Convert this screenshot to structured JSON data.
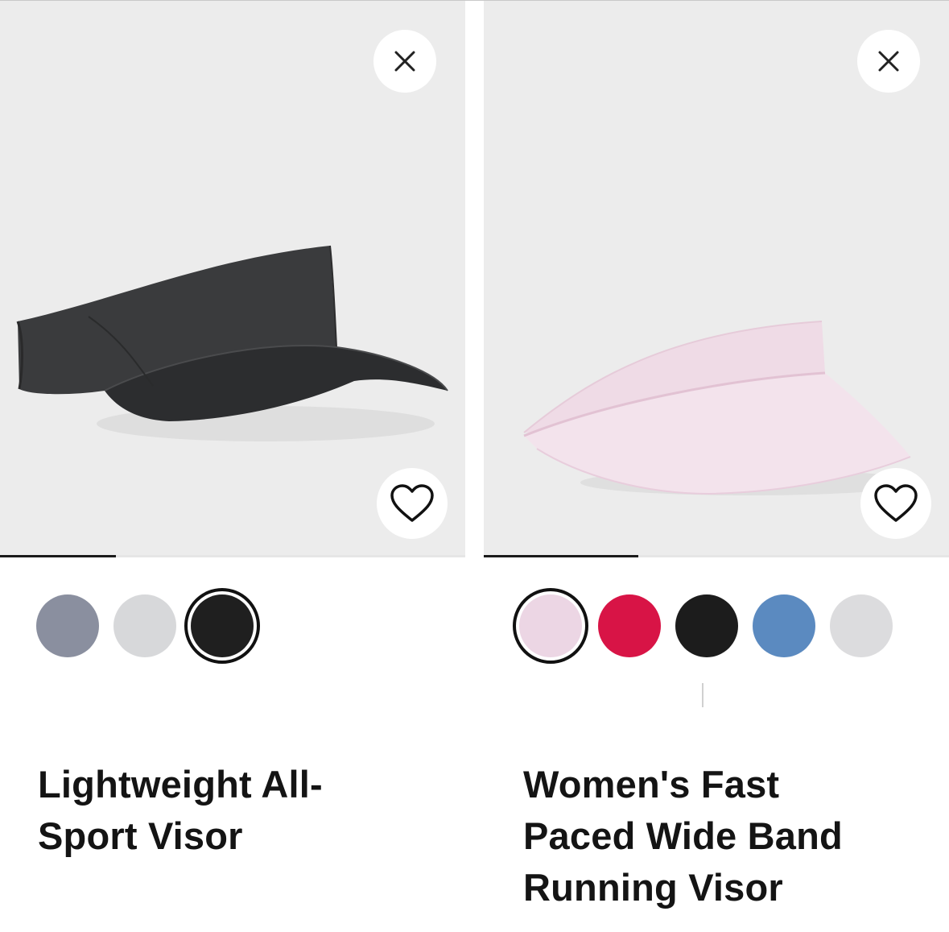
{
  "products": [
    {
      "title": "Lightweight All-Sport Visor",
      "close_icon": "close-icon",
      "favorite_icon": "heart-outline-icon",
      "carousel_progress": 0.25,
      "swatches": [
        {
          "color": "#8a8f9f",
          "selected": false
        },
        {
          "color": "#d7d8da",
          "selected": false
        },
        {
          "color": "#1f1f1f",
          "selected": true
        }
      ]
    },
    {
      "title": "Women's Fast Paced Wide Band Running Visor",
      "close_icon": "close-icon",
      "favorite_icon": "heart-outline-icon",
      "carousel_progress": 0.333,
      "swatches": [
        {
          "color": "#ecd6e4",
          "selected": true
        },
        {
          "color": "#d81446",
          "selected": false
        },
        {
          "color": "#1c1c1c",
          "selected": false
        },
        {
          "color": "#5b8ac0",
          "selected": false
        },
        {
          "color": "#dcdcde",
          "selected": false
        }
      ]
    }
  ],
  "colors": {
    "image_background": "#ececec",
    "progress_fill": "#1a1a1a",
    "progress_track": "#e6e6e6"
  }
}
